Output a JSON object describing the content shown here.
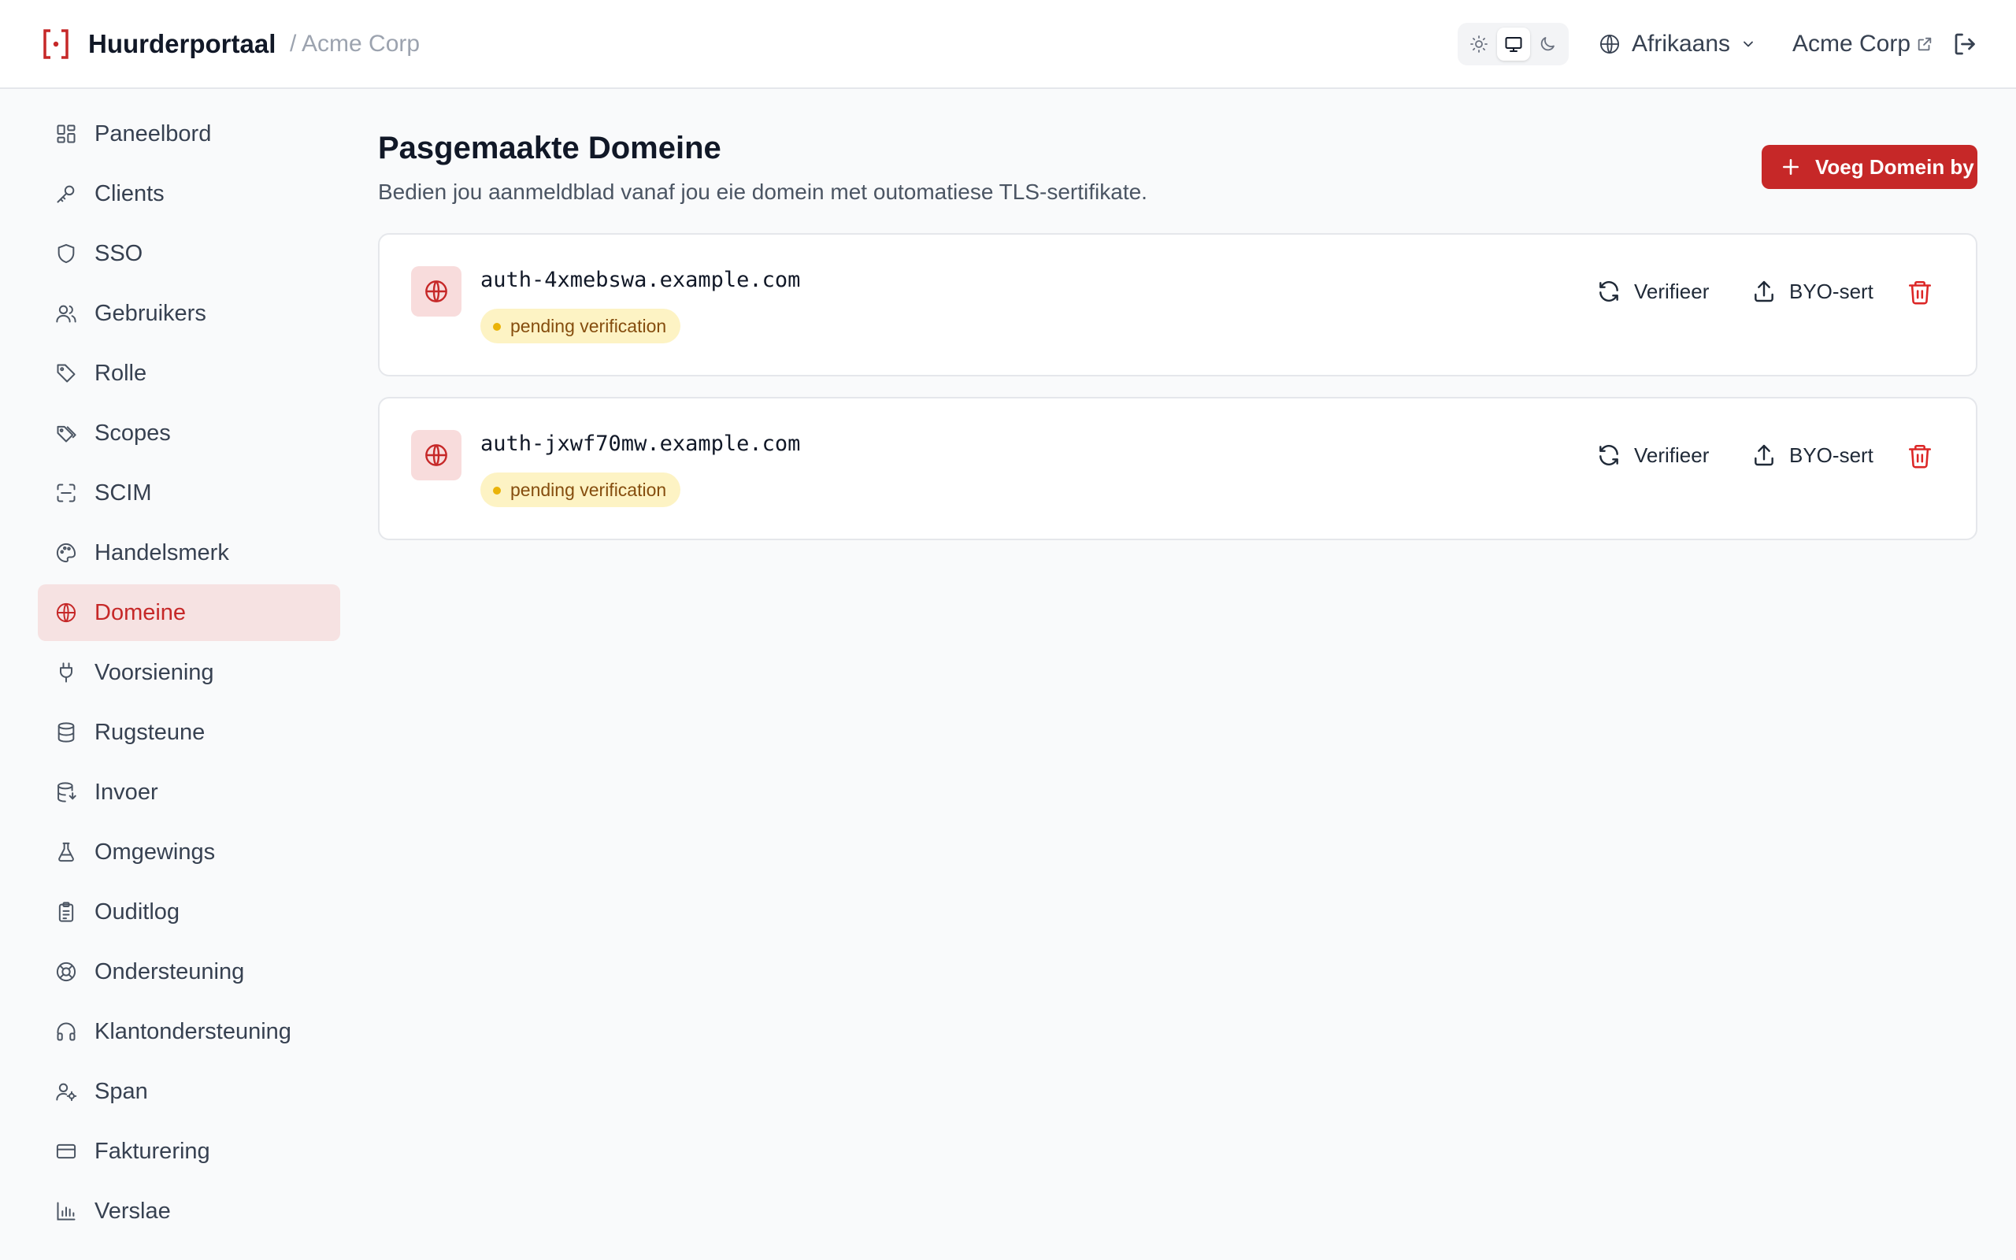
{
  "header": {
    "app_title": "Huurderportaal",
    "breadcrumb": "/ Acme Corp",
    "language": "Afrikaans",
    "tenant": "Acme Corp",
    "theme_active": "system"
  },
  "sidebar": {
    "active": "Domeine",
    "items": [
      {
        "label": "Paneelbord",
        "icon": "dashboard-icon"
      },
      {
        "label": "Clients",
        "icon": "key-icon"
      },
      {
        "label": "SSO",
        "icon": "shield-icon"
      },
      {
        "label": "Gebruikers",
        "icon": "users-icon"
      },
      {
        "label": "Rolle",
        "icon": "tag-icon"
      },
      {
        "label": "Scopes",
        "icon": "tags-icon"
      },
      {
        "label": "SCIM",
        "icon": "scan-icon"
      },
      {
        "label": "Handelsmerk",
        "icon": "palette-icon"
      },
      {
        "label": "Domeine",
        "icon": "globe-icon"
      },
      {
        "label": "Voorsiening",
        "icon": "plug-icon"
      },
      {
        "label": "Rugsteune",
        "icon": "database-icon"
      },
      {
        "label": "Invoer",
        "icon": "database-import-icon"
      },
      {
        "label": "Omgewings",
        "icon": "flask-icon"
      },
      {
        "label": "Ouditlog",
        "icon": "clipboard-icon"
      },
      {
        "label": "Ondersteuning",
        "icon": "lifebuoy-icon"
      },
      {
        "label": "Klantondersteuning",
        "icon": "headphones-icon"
      },
      {
        "label": "Span",
        "icon": "user-cog-icon"
      },
      {
        "label": "Fakturering",
        "icon": "credit-card-icon"
      },
      {
        "label": "Verslae",
        "icon": "bar-chart-icon"
      }
    ]
  },
  "main": {
    "title": "Pasgemaakte Domeine",
    "subtitle": "Bedien jou aanmeldblad vanaf jou eie domein met outomatiese TLS-sertifikate.",
    "add_button": "Voeg Domein by",
    "domains": [
      {
        "name": "auth-4xmebswa.example.com",
        "status": "pending verification",
        "verify_label": "Verifieer",
        "byo_label": "BYO-sert"
      },
      {
        "name": "auth-jxwf70mw.example.com",
        "status": "pending verification",
        "verify_label": "Verifieer",
        "byo_label": "BYO-sert"
      }
    ]
  },
  "colors": {
    "accent": "#c62828",
    "active_bg": "#f6e2e2",
    "badge_bg": "#fdf3c4",
    "badge_text": "#854d0e"
  }
}
